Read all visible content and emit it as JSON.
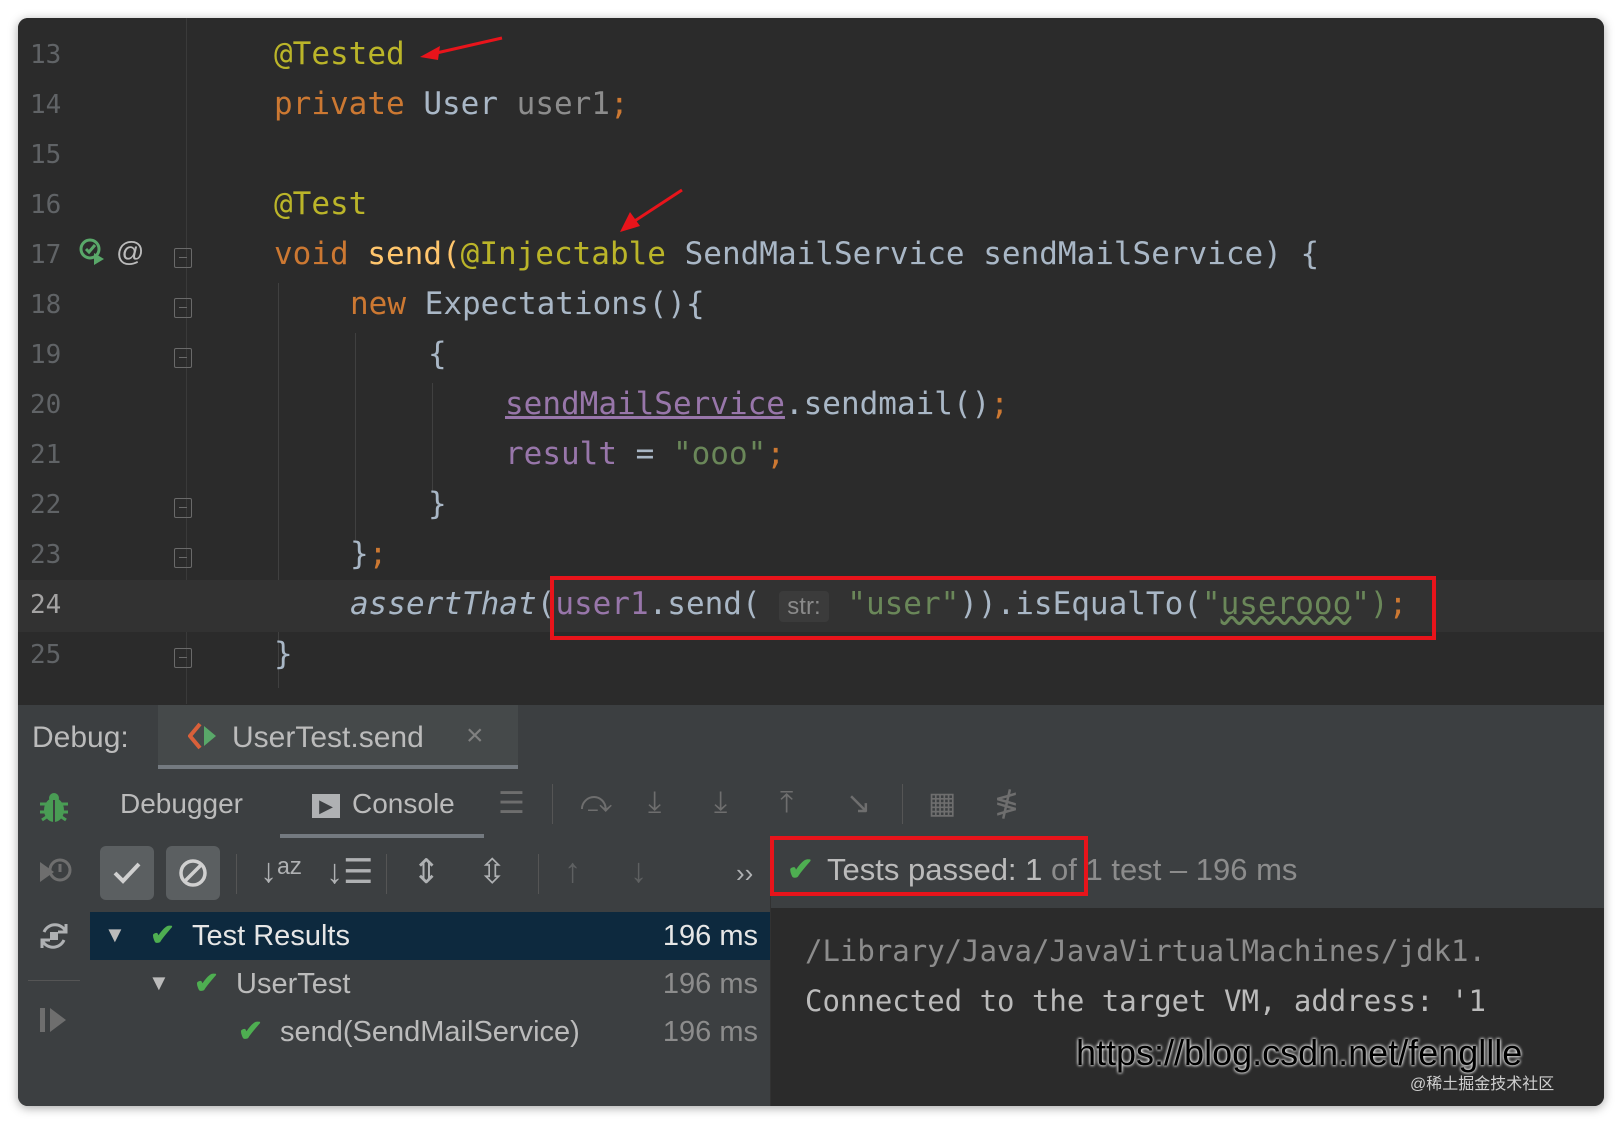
{
  "editor": {
    "line_numbers": [
      "13",
      "14",
      "15",
      "16",
      "17",
      "18",
      "19",
      "20",
      "21",
      "22",
      "23",
      "24",
      "25"
    ],
    "l13": {
      "annotation": "@Tested"
    },
    "l14": {
      "kw": "private",
      "type": "User",
      "field": "user1",
      "semi": ";"
    },
    "l16": {
      "annotation": "@Test"
    },
    "l17": {
      "kw": "void",
      "method": "send",
      "open": "(",
      "annotation": "@Injectable",
      "rest": " SendMailService sendMailService) {",
      "at_icon": "@"
    },
    "l18": {
      "kw": "new",
      "rest": " Expectations(){"
    },
    "l19": {
      "text": "{"
    },
    "l20": {
      "field": "sendMailService",
      "rest": ".sendmail()",
      "semi": ";"
    },
    "l21": {
      "field": "result",
      "eq": " = ",
      "str": "\"ooo\"",
      "semi": ";"
    },
    "l22": {
      "text": "}"
    },
    "l23": {
      "text": "}",
      "semi": ";"
    },
    "l24": {
      "call": "assertThat",
      "open": "(",
      "obj": "user1",
      "method": ".send(",
      "hint": "str:",
      "arg": "\"user\"",
      "mid": ")).isEqualTo(",
      "q1": "\"",
      "expected": "userooo",
      "q2": "\")",
      "semi": ";"
    },
    "l25": {
      "text": "}"
    }
  },
  "debug": {
    "label": "Debug:",
    "tab_title": "UserTest.send",
    "tab_close": "×",
    "subtabs": {
      "debugger": "Debugger",
      "console": "Console"
    },
    "more": "››",
    "status": {
      "passed": "Tests passed: 1",
      "rest": " of 1 test – 196 ms"
    },
    "tree": [
      {
        "name": "Test Results",
        "time": "196 ms"
      },
      {
        "name": "UserTest",
        "time": "196 ms"
      },
      {
        "name": "send(SendMailService)",
        "time": "196 ms"
      }
    ],
    "console_lines": [
      "/Library/Java/JavaVirtualMachines/jdk1.",
      "Connected to the target VM, address: '1"
    ]
  },
  "watermark": {
    "url": "https://blog.csdn.net/fengllle",
    "small": "@稀土掘金技术社区"
  },
  "colors": {
    "accent_red": "#e8141b",
    "pass_green": "#4eae51",
    "background": "#2b2b2b"
  }
}
